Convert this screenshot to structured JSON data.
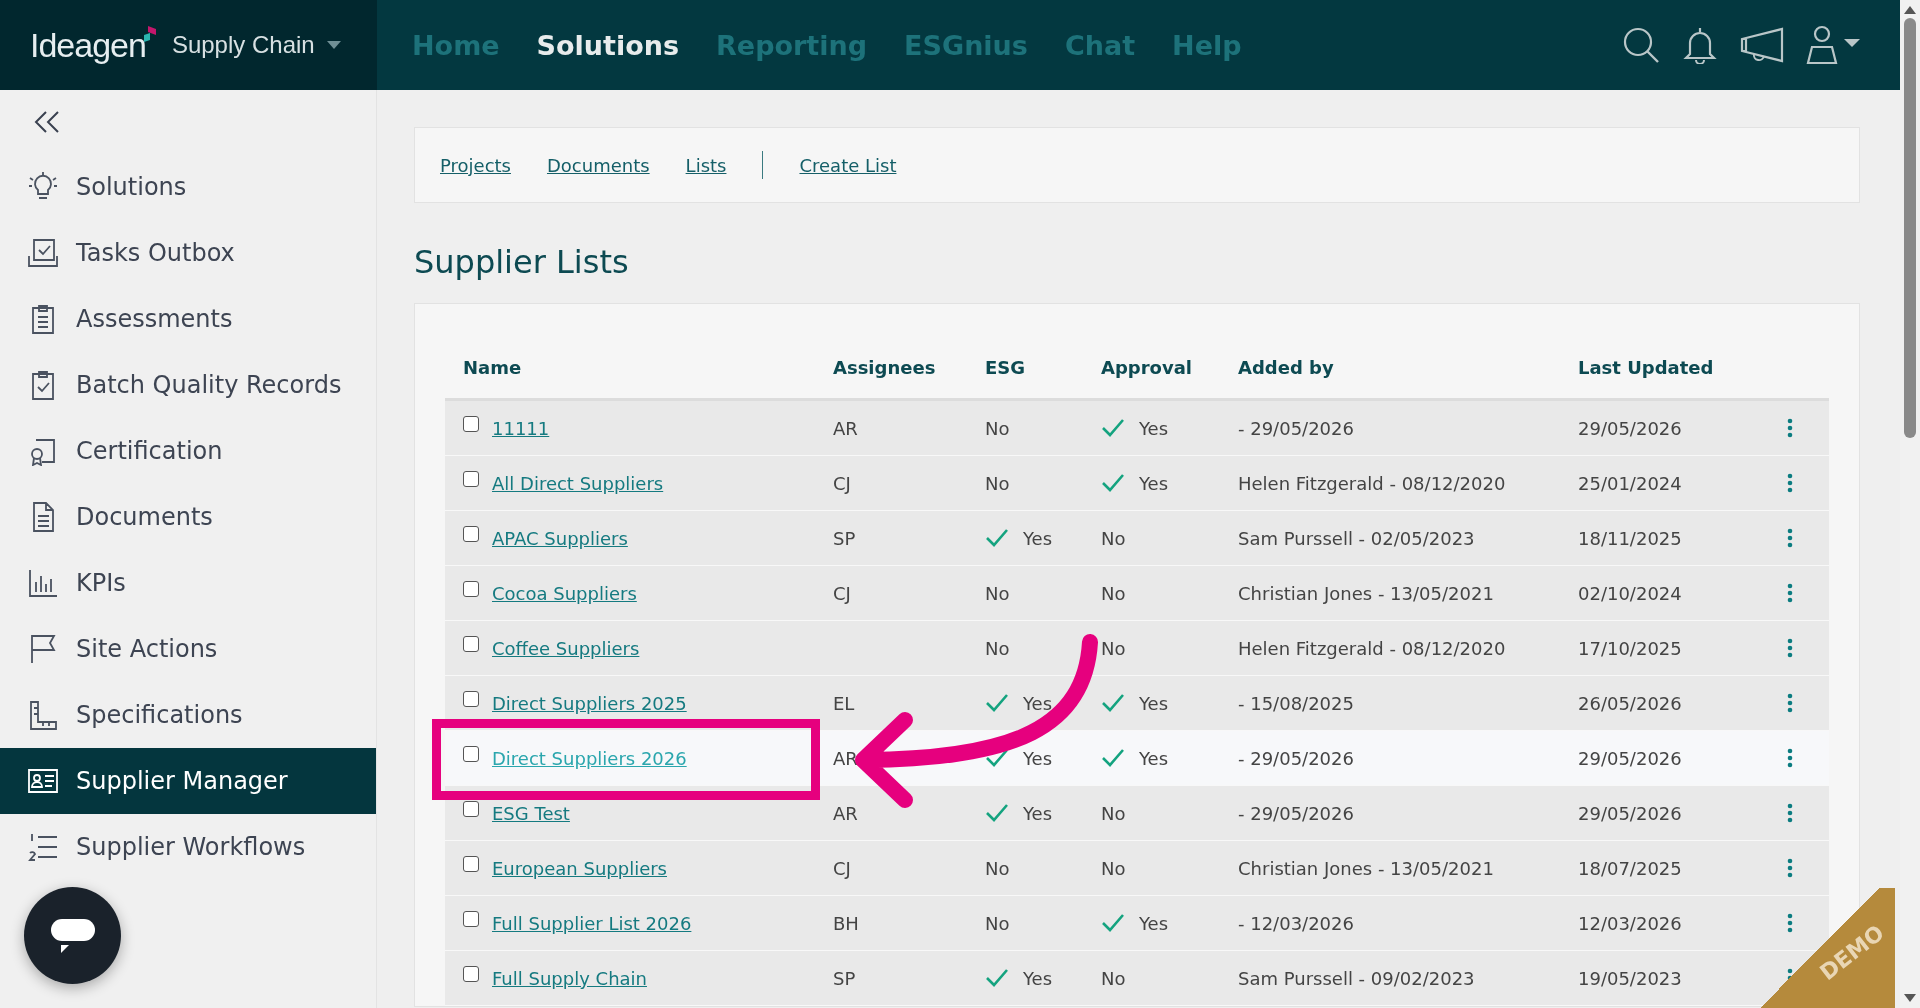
{
  "header": {
    "logo": "Ideagen",
    "product": "Supply Chain",
    "nav": [
      {
        "label": "Home",
        "selected": false
      },
      {
        "label": "Solutions",
        "selected": true
      },
      {
        "label": "Reporting",
        "selected": false
      },
      {
        "label": "ESGnius",
        "selected": false
      },
      {
        "label": "Chat",
        "selected": false
      },
      {
        "label": "Help",
        "selected": false
      }
    ]
  },
  "sidebar": {
    "items": [
      {
        "label": "Solutions",
        "selected": false
      },
      {
        "label": "Tasks Outbox",
        "selected": false
      },
      {
        "label": "Assessments",
        "selected": false
      },
      {
        "label": "Batch Quality Records",
        "selected": false
      },
      {
        "label": "Certification",
        "selected": false
      },
      {
        "label": "Documents",
        "selected": false
      },
      {
        "label": "KPIs",
        "selected": false
      },
      {
        "label": "Site Actions",
        "selected": false
      },
      {
        "label": "Specifications",
        "selected": false
      },
      {
        "label": "Supplier Manager",
        "selected": true
      },
      {
        "label": "Supplier Workflows",
        "selected": false
      }
    ]
  },
  "subnav": {
    "links": [
      "Projects",
      "Documents",
      "Lists"
    ],
    "action": "Create List"
  },
  "page_title": "Supplier Lists",
  "table": {
    "columns": [
      "Name",
      "Assignees",
      "ESG",
      "Approval",
      "Added by",
      "Last Updated"
    ],
    "rows": [
      {
        "name": "11111",
        "assignees": "AR",
        "esg": {
          "text": "No",
          "tick": false
        },
        "approval": {
          "text": "Yes",
          "tick": true
        },
        "added_by": "- 29/05/2026",
        "last_updated": "29/05/2026",
        "checked": false,
        "highlighted": false
      },
      {
        "name": "All Direct Suppliers",
        "assignees": "CJ",
        "esg": {
          "text": "No",
          "tick": false
        },
        "approval": {
          "text": "Yes",
          "tick": true
        },
        "added_by": "Helen Fitzgerald - 08/12/2020",
        "last_updated": "25/01/2024",
        "checked": false,
        "highlighted": false
      },
      {
        "name": "APAC Suppliers",
        "assignees": "SP",
        "esg": {
          "text": "Yes",
          "tick": true
        },
        "approval": {
          "text": "No",
          "tick": false
        },
        "added_by": "Sam Purssell - 02/05/2023",
        "last_updated": "18/11/2025",
        "checked": false,
        "highlighted": false
      },
      {
        "name": "Cocoa Suppliers",
        "assignees": "CJ",
        "esg": {
          "text": "No",
          "tick": false
        },
        "approval": {
          "text": "No",
          "tick": false
        },
        "added_by": "Christian Jones - 13/05/2021",
        "last_updated": "02/10/2024",
        "checked": false,
        "highlighted": false
      },
      {
        "name": "Coffee Suppliers",
        "esg": {
          "text": "No",
          "tick": false
        },
        "approval": {
          "text": "No",
          "tick": false
        },
        "added_by": "Helen Fitzgerald - 08/12/2020",
        "last_updated": "17/10/2025",
        "checked": false,
        "highlighted": false
      },
      {
        "name": "Direct Suppliers 2025",
        "assignees": "EL",
        "esg": {
          "text": "Yes",
          "tick": true
        },
        "approval": {
          "text": "Yes",
          "tick": true
        },
        "added_by": "- 15/08/2025",
        "last_updated": "26/05/2026",
        "checked": false,
        "highlighted": false
      },
      {
        "name": "Direct Suppliers 2026",
        "assignees": "AR",
        "esg": {
          "text": "Yes",
          "tick": true
        },
        "approval": {
          "text": "Yes",
          "tick": true
        },
        "added_by": "- 29/05/2026",
        "last_updated": "29/05/2026",
        "checked": false,
        "highlighted": true
      },
      {
        "name": "ESG Test",
        "assignees": "AR",
        "esg": {
          "text": "Yes",
          "tick": true
        },
        "approval": {
          "text": "No",
          "tick": false
        },
        "added_by": "- 29/05/2026",
        "last_updated": "29/05/2026",
        "checked": false,
        "highlighted": false
      },
      {
        "name": "European Suppliers",
        "assignees": "CJ",
        "esg": {
          "text": "No",
          "tick": false
        },
        "approval": {
          "text": "No",
          "tick": false
        },
        "added_by": "Christian Jones - 13/05/2021",
        "last_updated": "18/07/2025",
        "checked": false,
        "highlighted": false
      },
      {
        "name": "Full Supplier List 2026",
        "assignees": "BH",
        "esg": {
          "text": "No",
          "tick": false
        },
        "approval": {
          "text": "Yes",
          "tick": true
        },
        "added_by": "- 12/03/2026",
        "last_updated": "12/03/2026",
        "checked": false,
        "highlighted": false
      },
      {
        "name": "Full Supply Chain",
        "assignees": "SP",
        "esg": {
          "text": "Yes",
          "tick": true
        },
        "approval": {
          "text": "No",
          "tick": false
        },
        "added_by": "Sam Purssell - 09/02/2023",
        "last_updated": "19/05/2023",
        "checked": false,
        "highlighted": false
      }
    ]
  },
  "ribbon": "DEMO"
}
